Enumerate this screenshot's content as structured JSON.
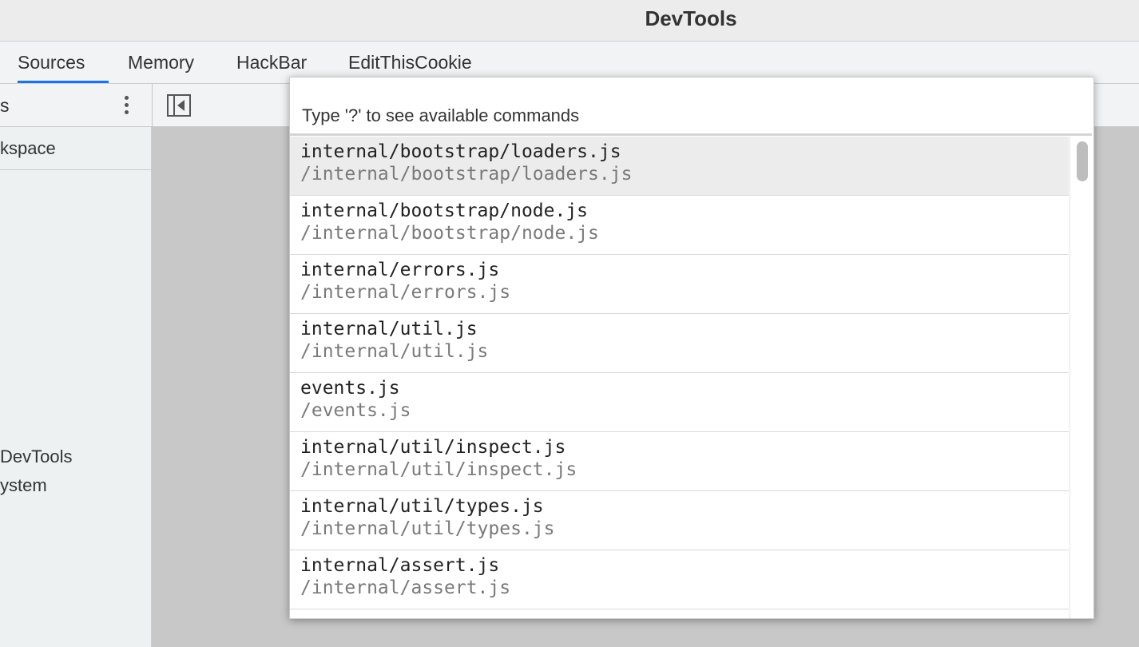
{
  "window": {
    "title": "DevTools"
  },
  "tabs": [
    {
      "label": "Sources",
      "active": true
    },
    {
      "label": "Memory",
      "active": false
    },
    {
      "label": "HackBar",
      "active": false
    },
    {
      "label": "EditThisCookie",
      "active": false
    }
  ],
  "sidebar": {
    "header_label": "s",
    "workspace_label": "kspace",
    "items": [
      {
        "label": "DevTools"
      },
      {
        "label": "ystem"
      }
    ]
  },
  "command_palette": {
    "placeholder": "Type '?' to see available commands",
    "results": [
      {
        "name": "internal/bootstrap/loaders.js",
        "path": "/internal/bootstrap/loaders.js",
        "selected": true
      },
      {
        "name": "internal/bootstrap/node.js",
        "path": "/internal/bootstrap/node.js",
        "selected": false
      },
      {
        "name": "internal/errors.js",
        "path": "/internal/errors.js",
        "selected": false
      },
      {
        "name": "internal/util.js",
        "path": "/internal/util.js",
        "selected": false
      },
      {
        "name": "events.js",
        "path": "/events.js",
        "selected": false
      },
      {
        "name": "internal/util/inspect.js",
        "path": "/internal/util/inspect.js",
        "selected": false
      },
      {
        "name": "internal/util/types.js",
        "path": "/internal/util/types.js",
        "selected": false
      },
      {
        "name": "internal/assert.js",
        "path": "/internal/assert.js",
        "selected": false
      }
    ]
  },
  "icons": {
    "more": "kebab-menu-icon",
    "toggle_navigator": "sidebar-toggle-icon"
  },
  "colors": {
    "accent": "#1a73e8",
    "selected_row": "#ececec",
    "path_text": "#7a7a7a"
  }
}
